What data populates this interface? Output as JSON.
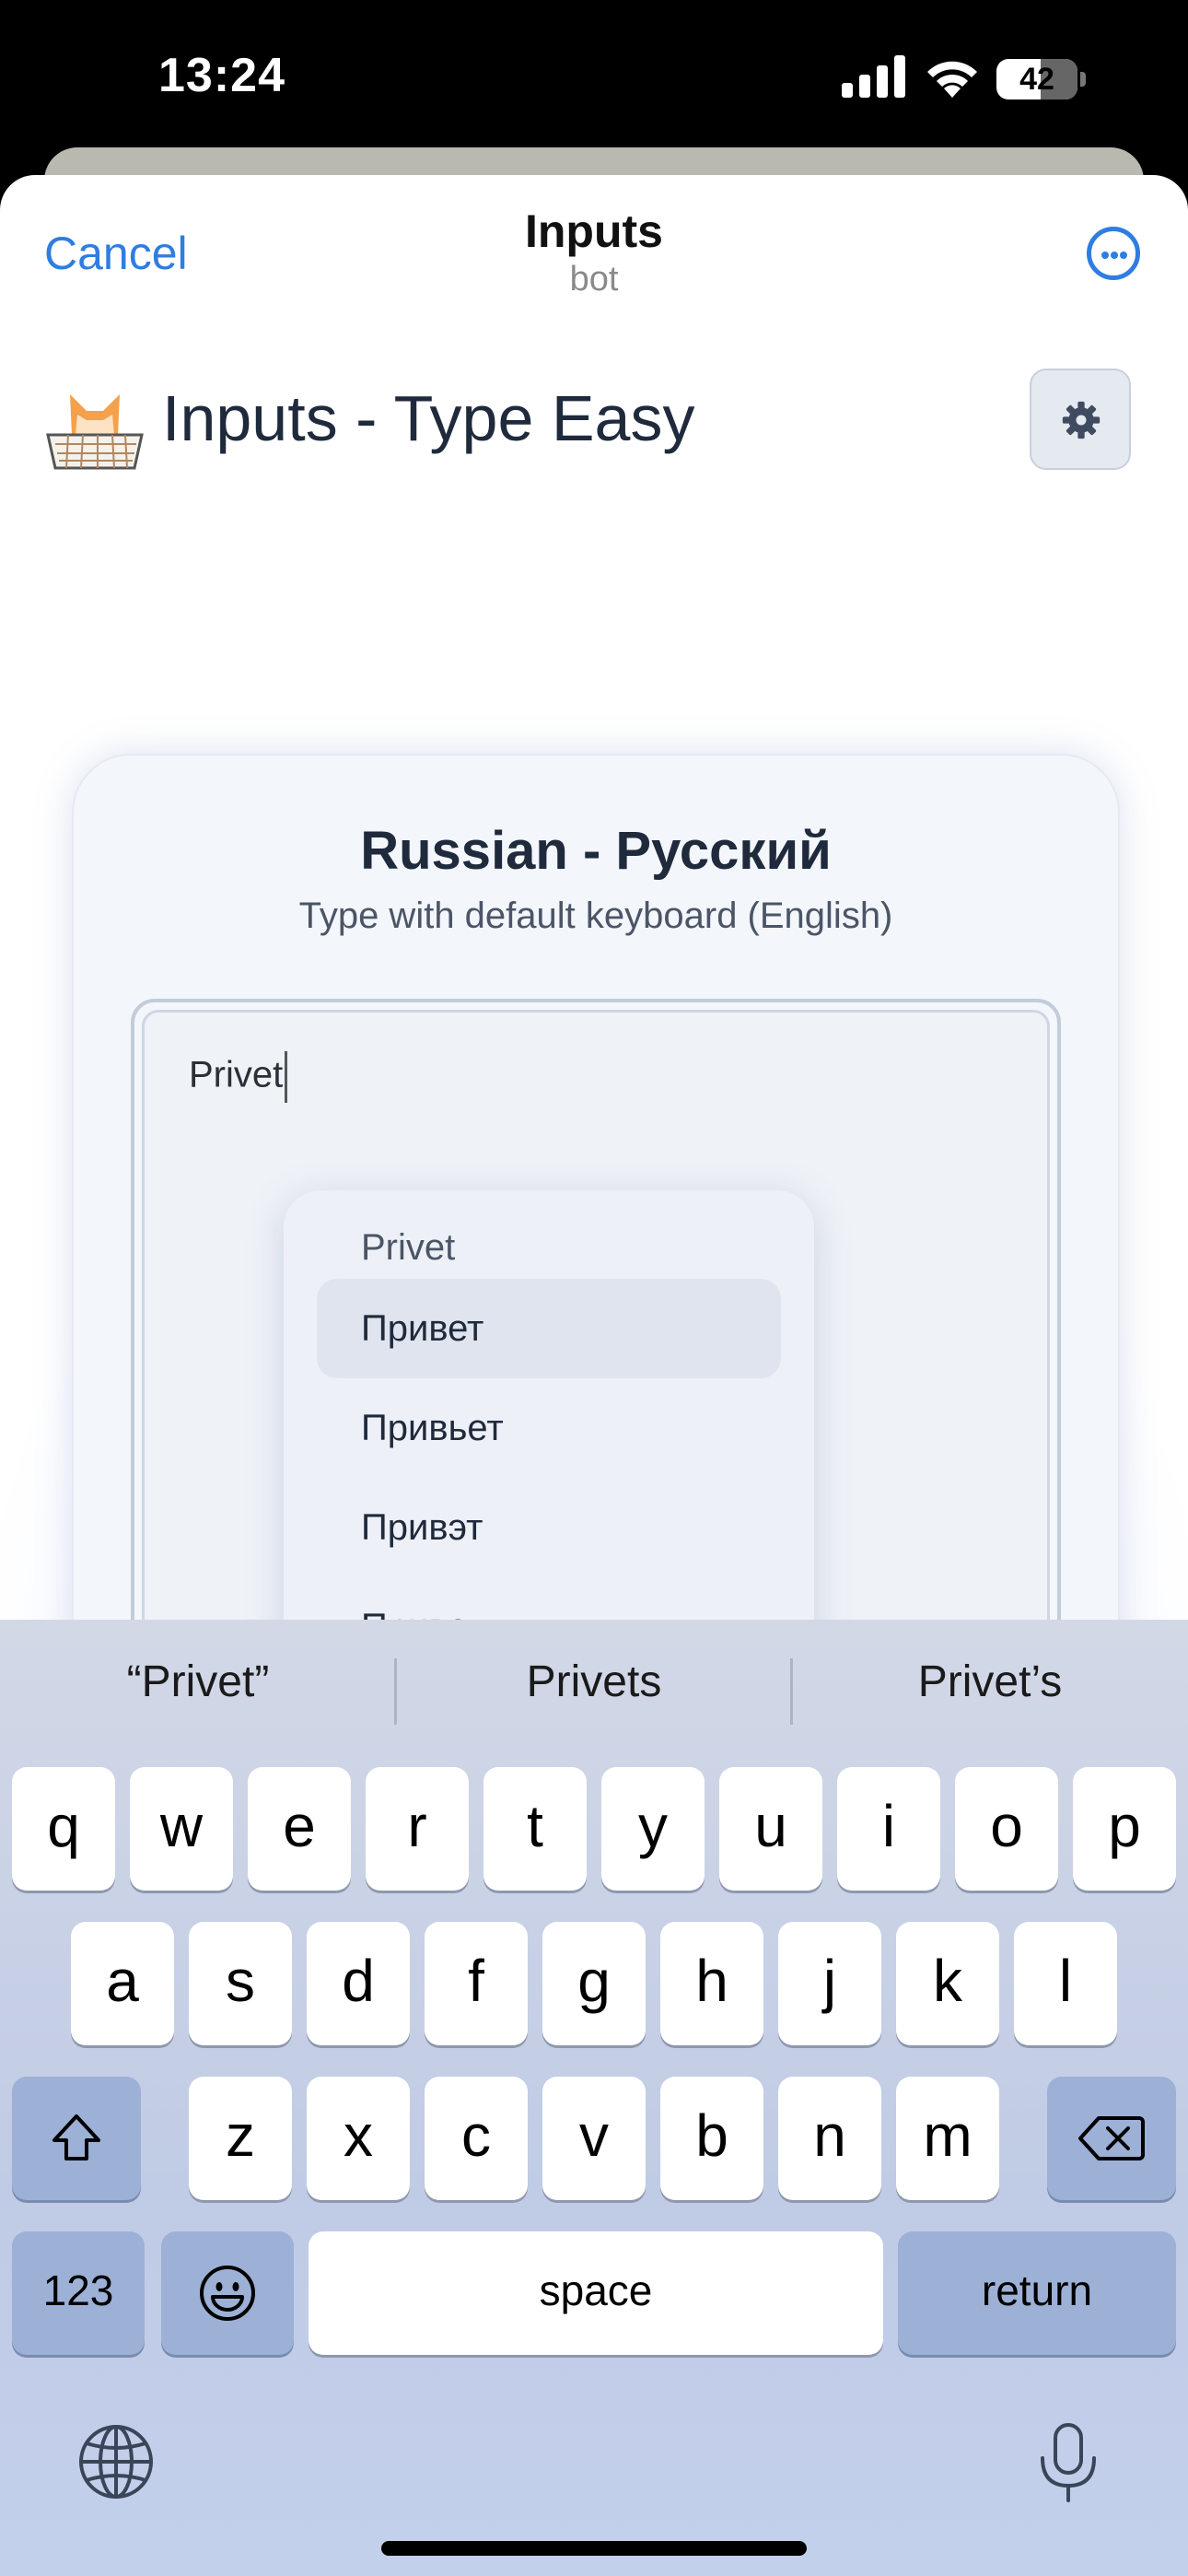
{
  "status_bar": {
    "time": "13:24",
    "battery": "42"
  },
  "nav": {
    "cancel": "Cancel",
    "title": "Inputs",
    "subtitle": "bot"
  },
  "app": {
    "title": "Inputs - Type Easy"
  },
  "card": {
    "title": "Russian - Русский",
    "subtitle": "Type with default keyboard (English)",
    "input_value": "Privet"
  },
  "suggestions": {
    "original": "Privet",
    "items": [
      "Привет",
      "Привьет",
      "Привэт",
      "Приветь"
    ]
  },
  "predictions": [
    "“Privet”",
    "Privets",
    "Privet’s"
  ],
  "keyboard": {
    "row1": [
      "q",
      "w",
      "e",
      "r",
      "t",
      "y",
      "u",
      "i",
      "o",
      "p"
    ],
    "row2": [
      "a",
      "s",
      "d",
      "f",
      "g",
      "h",
      "j",
      "k",
      "l"
    ],
    "row3": [
      "z",
      "x",
      "c",
      "v",
      "b",
      "n",
      "m"
    ],
    "numbers_label": "123",
    "space_label": "space",
    "return_label": "return"
  }
}
